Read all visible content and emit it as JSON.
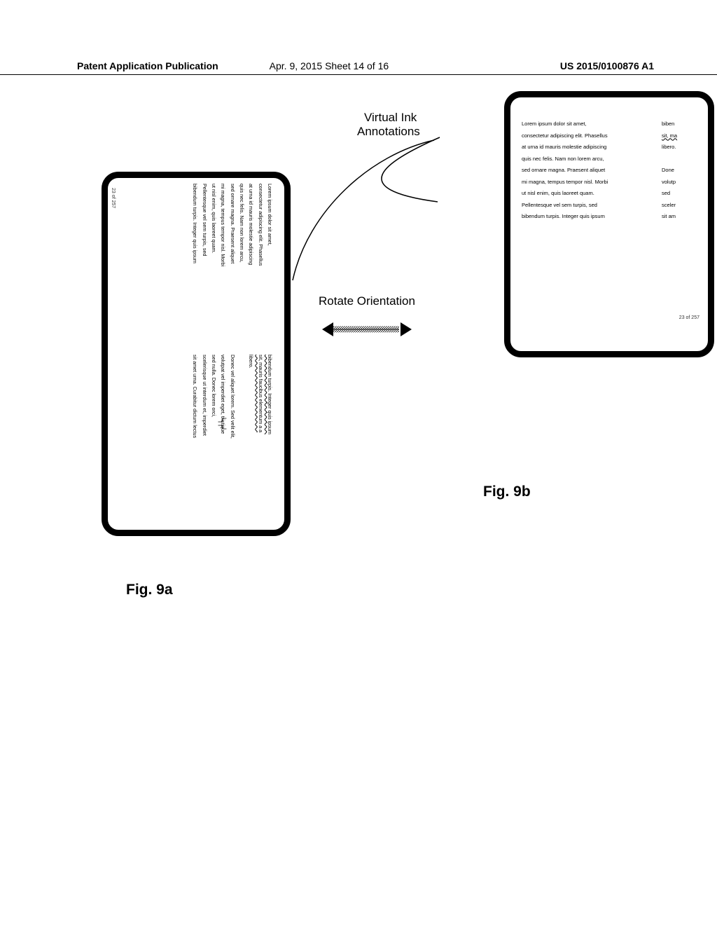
{
  "header": {
    "left": "Patent Application Publication",
    "mid": "Apr. 9, 2015   Sheet 14 of 16",
    "right": "US 2015/0100876 A1"
  },
  "labels": {
    "virtual_ink": "Virtual Ink",
    "annotations": "Annotations",
    "rotate": "Rotate Orientation",
    "fig9a": "Fig. 9a",
    "fig9b": "Fig. 9b"
  },
  "device_a": {
    "left_page": [
      "Lorem ipsum dolor sit amet,",
      "consectetur adipiscing elit. Phasellus",
      "at urna id mauris molestie adipiscing",
      "quis nec felis. Nam non lorem arcu,",
      "sed ornare magna. Praesent aliquet",
      "mi magna, tempus tempor nisl. Morbi",
      "ut nisl enim, quis laoreet quam.",
      "Pellentesque vel sem turpis, sed",
      "bibendum turpis. Integer quis ipsum"
    ],
    "right_page": [
      "bibendum turpis. Integer quis ipsum",
      "sit, mauris faucibus elementum a a",
      "libero.",
      "",
      "Donec vel aliquet lorem. Sed velit elit,",
      "volutpat vel imperdiet eget, tristique",
      "sed nulla. Donec lorem orci,",
      "scelerisque ut interdum et, imperdiet",
      "sit amet urna. Curabitur dictum lectus"
    ],
    "page_num": "23 of 257",
    "wavy_lines": [
      0,
      1
    ]
  },
  "device_b": {
    "rows": [
      {
        "l": "Lorem ipsum dolor sit amet,",
        "r": "biben"
      },
      {
        "l": "consectetur adipiscing elit. Phasellus",
        "r": "sit, ma"
      },
      {
        "l": "at urna id mauris molestie adipiscing",
        "r": "libero."
      },
      {
        "l": "quis nec felis. Nam non lorem arcu,",
        "r": ""
      },
      {
        "l": "sed ornare magna. Praesent aliquet",
        "r": "Done"
      },
      {
        "l": "mi magna, tempus tempor nisl. Morbi",
        "r": "volutp"
      },
      {
        "l": "ut nisl enim, quis laoreet quam.",
        "r": "sed"
      },
      {
        "l": "Pellentesque vel sem turpis, sed",
        "r": "sceler"
      },
      {
        "l": "bibendum turpis. Integer quis ipsum",
        "r": "sit am"
      }
    ],
    "page_num": "23 of 257",
    "wavy_rows_r": [
      1
    ]
  }
}
